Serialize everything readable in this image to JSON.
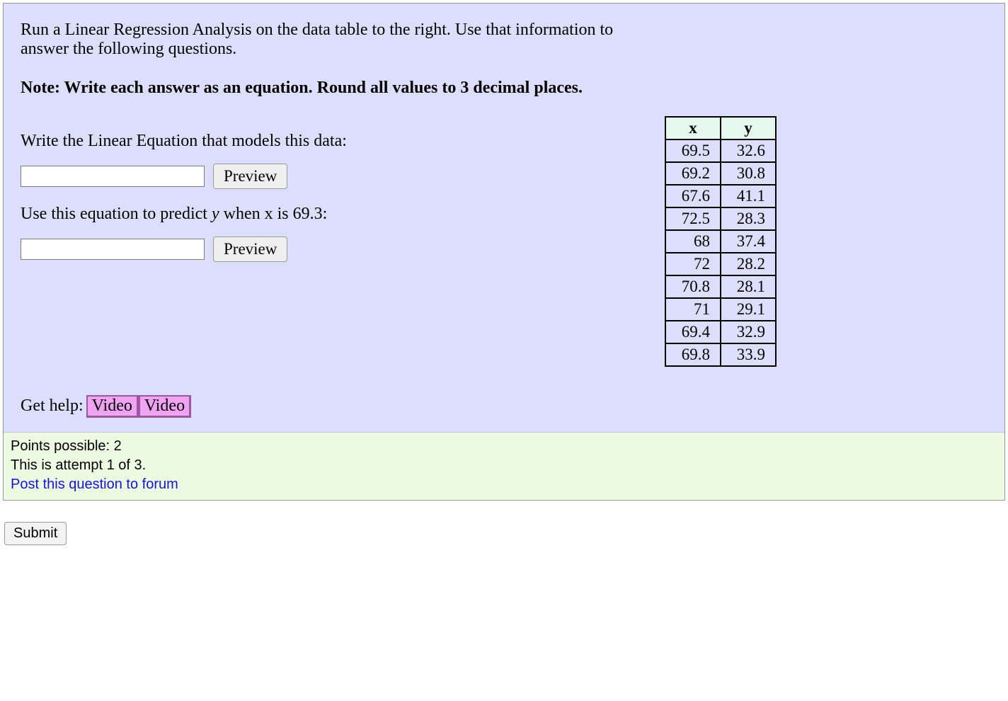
{
  "intro": "Run a Linear Regression Analysis on the data table to the right. Use that information to answer the following questions.",
  "note": "Note: Write each answer as an equation. Round all values to 3 decimal places.",
  "prompt1": "Write the Linear Equation that models this data:",
  "prompt2_pre": "Use this equation to predict ",
  "prompt2_var": "y",
  "prompt2_post": " when x is 69.3:",
  "preview_label": "Preview",
  "gethelp_label": "Get help:",
  "video_label": "Video",
  "table": {
    "headers": {
      "x": "x",
      "y": "y"
    },
    "rows": [
      {
        "x": "69.5",
        "y": "32.6"
      },
      {
        "x": "69.2",
        "y": "30.8"
      },
      {
        "x": "67.6",
        "y": "41.1"
      },
      {
        "x": "72.5",
        "y": "28.3"
      },
      {
        "x": "68",
        "y": "37.4"
      },
      {
        "x": "72",
        "y": "28.2"
      },
      {
        "x": "70.8",
        "y": "28.1"
      },
      {
        "x": "71",
        "y": "29.1"
      },
      {
        "x": "69.4",
        "y": "32.9"
      },
      {
        "x": "69.8",
        "y": "33.9"
      }
    ]
  },
  "footer": {
    "points": "Points possible: 2",
    "attempt": "This is attempt 1 of 3.",
    "forum": "Post this question to forum"
  },
  "submit_label": "Submit"
}
